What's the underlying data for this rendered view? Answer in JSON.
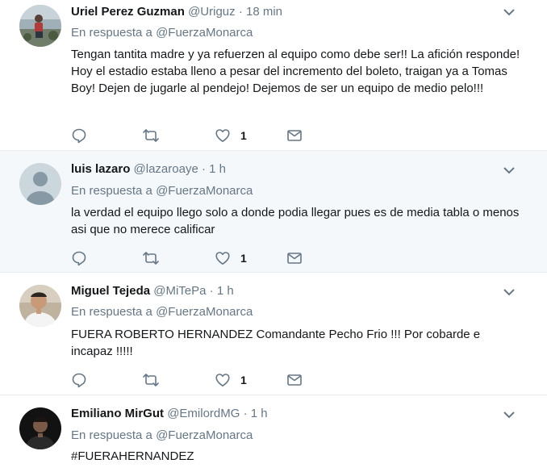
{
  "tweets": [
    {
      "name": "Uriel Perez Guzman",
      "handle": "@Uriguz",
      "separator": "·",
      "time": "18 min",
      "reply_prefix": "En respuesta a",
      "reply_to": "@FuerzaMonarca",
      "text": "Tengan tantita madre y ya refuerzen al equipo como debe ser!! La afición responde! Hoy el estadio estaba lleno a pesar del incremento del boleto, traigan ya a Tomas Boy! Dejen de jugarle al pendejo! Dejemos de ser un equipo de medio pelo!!!",
      "like_count": "1",
      "avatar": "photo"
    },
    {
      "name": "luis lazaro",
      "handle": "@lazaroaye",
      "separator": "·",
      "time": "1 h",
      "reply_prefix": "En respuesta a",
      "reply_to": "@FuerzaMonarca",
      "text": "la verdad el equipo llego solo  a donde podia llegar pues es de media tabla  o menos asi que no merece calificar",
      "like_count": "1",
      "avatar": "default-user-icon"
    },
    {
      "name": "Miguel Tejeda",
      "handle": "@MiTePa",
      "separator": "·",
      "time": "1 h",
      "reply_prefix": "En respuesta a",
      "reply_to": "@FuerzaMonarca",
      "text": "FUERA ROBERTO HERNANDEZ Comandante Pecho Frio !!! Por cobarde e incapaz !!!!!",
      "like_count": "1",
      "avatar": "photo"
    },
    {
      "name": "Emiliano MirGut",
      "handle": "@EmilordMG",
      "separator": "·",
      "time": "1 h",
      "reply_prefix": "En respuesta a",
      "reply_to": "@FuerzaMonarca",
      "text": "#FUERAHERNANDEZ",
      "avatar": "photo"
    }
  ],
  "icons": {
    "reply": "reply-icon",
    "retweet": "retweet-icon",
    "like": "heart-icon",
    "dm": "envelope-icon",
    "more": "chevron-down-icon"
  },
  "colors": {
    "icon": "#657786",
    "highlight_bg": "#f5f8fa",
    "divider": "#e6ecf0"
  }
}
